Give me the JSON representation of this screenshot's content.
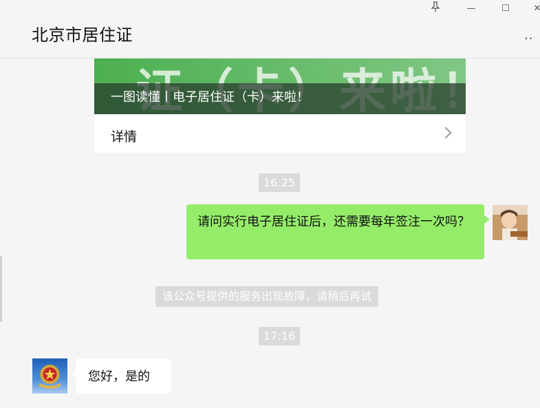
{
  "window": {
    "pin_icon": "pin-icon",
    "minimize_glyph": "—",
    "maximize_glyph": "☐",
    "close_glyph": "✕"
  },
  "header": {
    "title": "北京市居住证",
    "more_glyph": "··"
  },
  "article": {
    "banner_text": "证（卡）来啦！",
    "title": "一图读懂丨电子居住证（卡）来啦！",
    "details_label": "详情"
  },
  "messages": {
    "time1": "16:25",
    "outgoing_text": "请问实行电子居住证后，还需要每年签注一次吗？",
    "system_notice": "该公众号提供的服务出现故障，请稍后再试",
    "time2": "17:16",
    "incoming_text": "您好，是的"
  },
  "colors": {
    "outgoing_bubble": "#95ec69",
    "timestamp_pill": "#dadada",
    "banner_green": "#4caf50"
  }
}
